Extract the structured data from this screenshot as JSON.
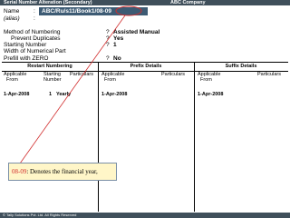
{
  "titlebar": {
    "left": "Serial Number Alteration (Secondary)",
    "right": "ABC Company"
  },
  "form": {
    "name_label": "Name",
    "name_sep": ":",
    "name_value": "ABC/Ru/s11/Book1/08-09",
    "alias_label": "(alias)",
    "alias_sep": ":",
    "rows": [
      {
        "label": "Method of Numbering",
        "value": "Assisted Manual"
      },
      {
        "label": "Prevent Duplicates",
        "value": "Yes"
      },
      {
        "label": "Starting Number",
        "value": "1"
      },
      {
        "label": "Width of Numerical Part",
        "value": ""
      },
      {
        "label": "Prefill with ZERO",
        "value": "No"
      }
    ],
    "row_sep": "?"
  },
  "table": {
    "sections": [
      "Restart Numbering",
      "Prefix Details",
      "Suffix Details"
    ],
    "restart": {
      "col1": "Applicable\n  From",
      "col2": "Starting\nNumber",
      "col3": "Particulars"
    },
    "prefix": {
      "col1": "Applicable\n  From",
      "col2": "Particulars"
    },
    "suffix": {
      "col1": "Applicable\n  From",
      "col2": "Particulars"
    },
    "row": {
      "restart_from": "1-Apr-2008",
      "restart_number": "1",
      "restart_particulars": "Yearly",
      "prefix_from": "1-Apr-2008",
      "suffix_from": "1-Apr-2008"
    }
  },
  "callout": {
    "highlight": "08-09",
    "text": ": Denotes the financial year,"
  },
  "footer": "© Tally Solutions Pvt. Ltd. All Rights Reserved",
  "colors": {
    "titlebar": "#3f4f5b",
    "name_field": "#3d5b74",
    "annotation_red": "#d12d2d",
    "callout_bg": "#fff6c8"
  }
}
